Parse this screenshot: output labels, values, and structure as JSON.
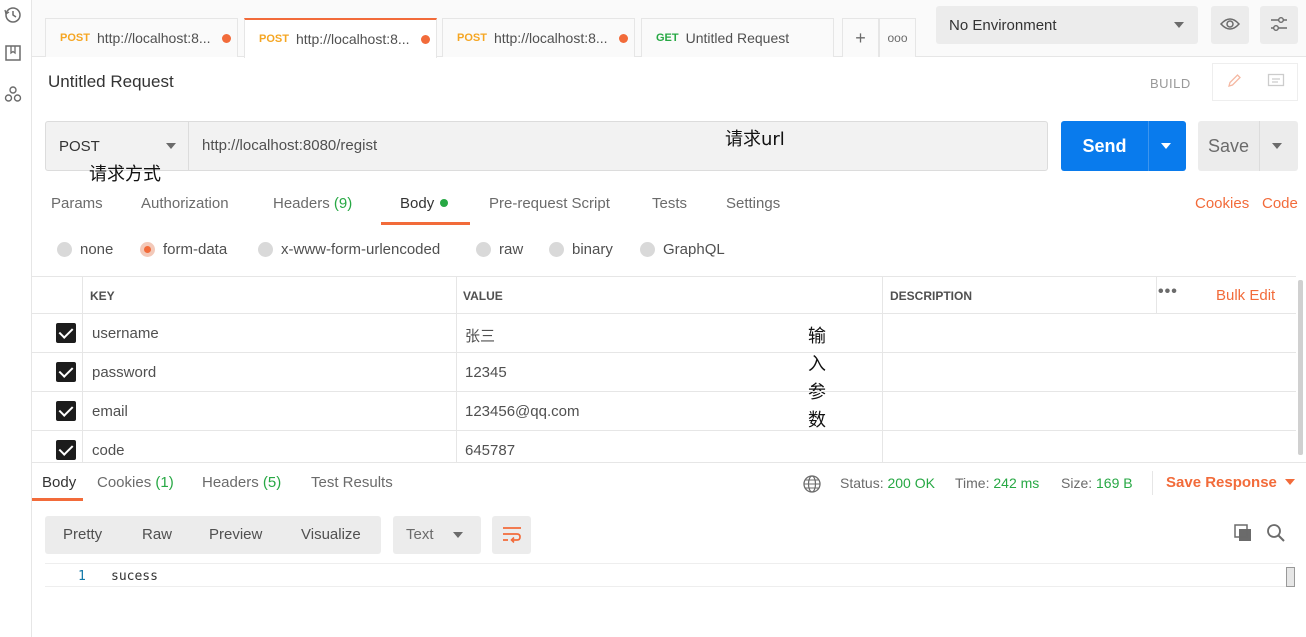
{
  "tabs": [
    {
      "method": "POST",
      "url": "http://localhost:8..."
    },
    {
      "method": "POST",
      "url": "http://localhost:8..."
    },
    {
      "method": "POST",
      "url": "http://localhost:8..."
    },
    {
      "method": "GET",
      "url": "Untitled Request"
    }
  ],
  "tabbar": {
    "add_glyph": "+",
    "more_glyph": "ooo"
  },
  "environment": {
    "selected": "No Environment"
  },
  "request": {
    "title": "Untitled Request",
    "build_label": "BUILD",
    "method": "POST",
    "url": "http://localhost:8080/regist",
    "send_label": "Send",
    "save_label": "Save"
  },
  "annotations": {
    "method_note": "请求方式",
    "url_note": "请求url",
    "params_note": [
      "输",
      "入",
      "参",
      "数"
    ]
  },
  "request_tabs": {
    "params": "Params",
    "authorization": "Authorization",
    "headers": "Headers",
    "headers_count": "(9)",
    "body": "Body",
    "prerequest": "Pre-request Script",
    "tests": "Tests",
    "settings": "Settings",
    "cookies_link": "Cookies",
    "code_link": "Code"
  },
  "body_types": [
    "none",
    "form-data",
    "x-www-form-urlencoded",
    "raw",
    "binary",
    "GraphQL"
  ],
  "body_type_selected": "form-data",
  "params_table": {
    "headers": {
      "key": "KEY",
      "value": "VALUE",
      "description": "DESCRIPTION"
    },
    "more_glyph": "•••",
    "bulk_edit": "Bulk Edit",
    "rows": [
      {
        "key": "username",
        "value": "张三",
        "checked": true
      },
      {
        "key": "password",
        "value": "12345",
        "checked": true
      },
      {
        "key": "email",
        "value": "123456@qq.com",
        "checked": true
      },
      {
        "key": "code",
        "value": "645787",
        "checked": true
      }
    ]
  },
  "response": {
    "tabs": {
      "body": "Body",
      "cookies": "Cookies",
      "cookies_count": "(1)",
      "headers": "Headers",
      "headers_count": "(5)",
      "test_results": "Test Results"
    },
    "status_label": "Status:",
    "status_value": "200 OK",
    "time_label": "Time:",
    "time_value": "242 ms",
    "size_label": "Size:",
    "size_value": "169 B",
    "save_response": "Save Response",
    "views": {
      "pretty": "Pretty",
      "raw": "Raw",
      "preview": "Preview",
      "visualize": "Visualize"
    },
    "format": "Text",
    "line_number": "1",
    "body_text": "sucess"
  },
  "colors": {
    "accent": "#f26b3a",
    "send": "#097bed",
    "status_ok": "#27a844"
  }
}
